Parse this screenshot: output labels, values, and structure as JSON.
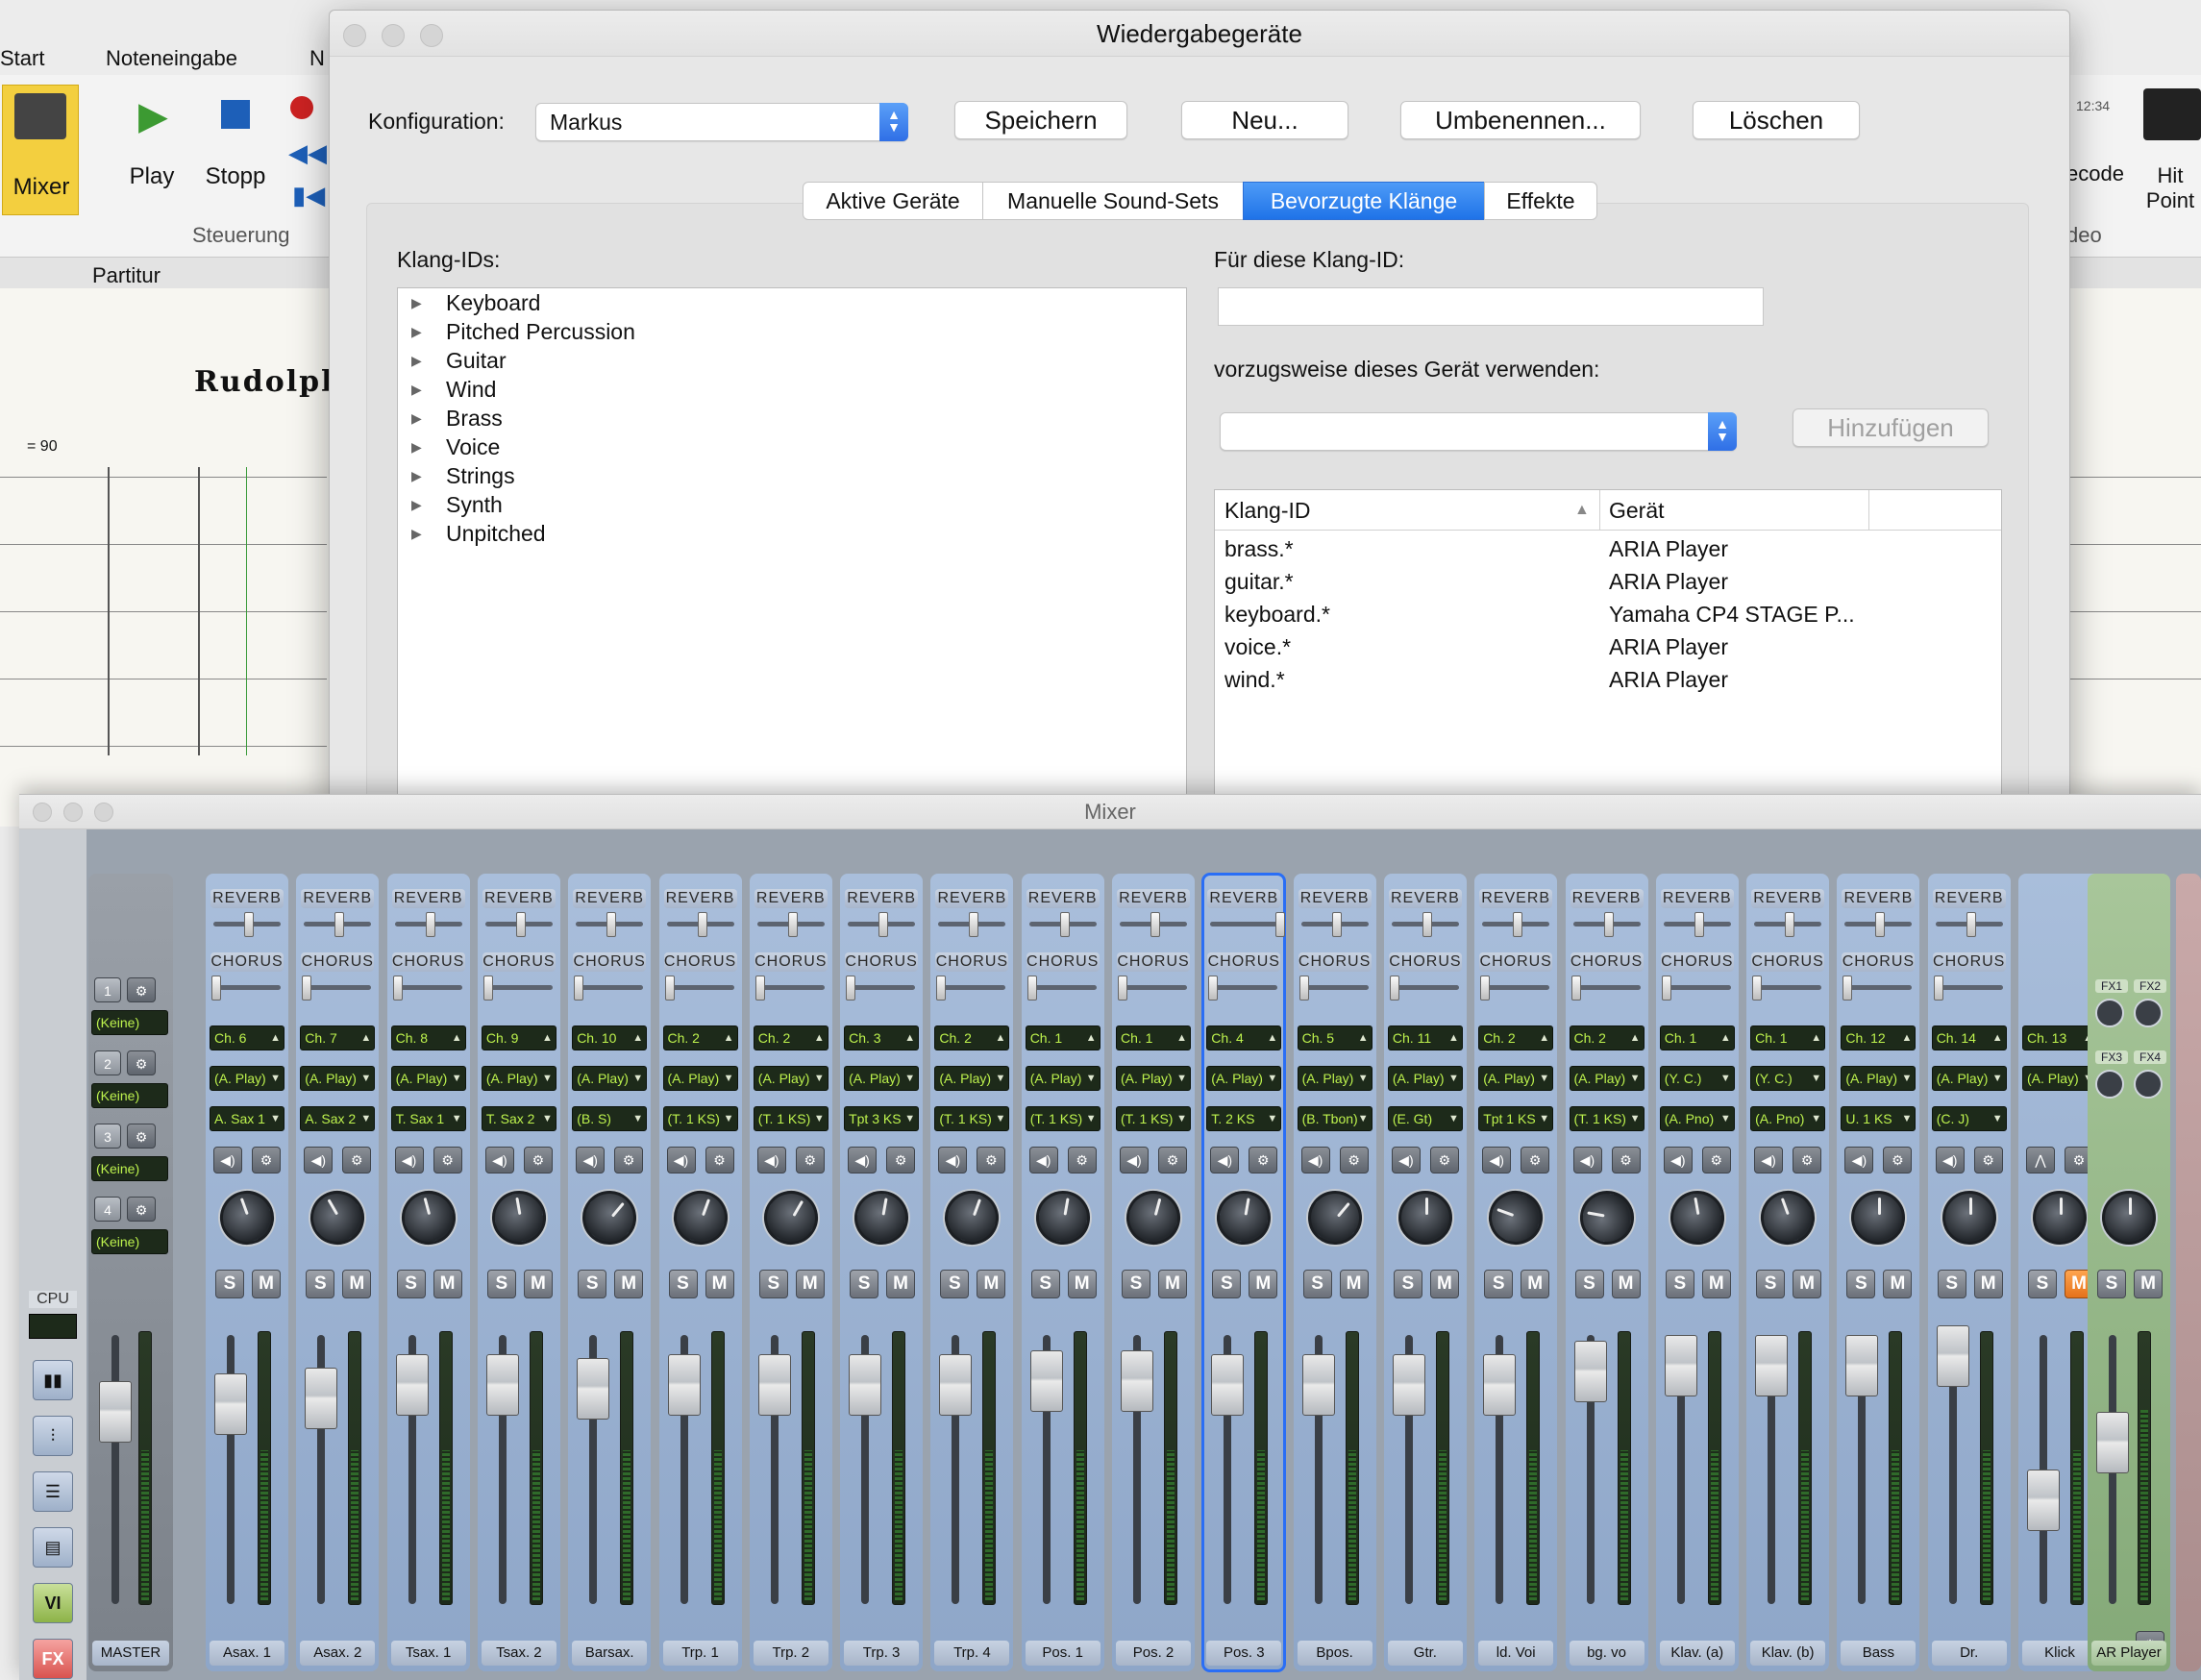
{
  "background_app": {
    "tabs": [
      "Start",
      "Noteneingabe",
      "N"
    ],
    "buttons": {
      "mixer": "Mixer",
      "play": "Play",
      "stopp": "Stopp"
    },
    "groups": {
      "steuerung": "Steuerung",
      "partitur": "Partitur",
      "timecode": "ecode",
      "hitpoint": "Hit Point",
      "video": "deo",
      "time": "12:34"
    },
    "score_title": "Rudolph, T",
    "tempo": "= 90"
  },
  "dialog": {
    "title": "Wiedergabegeräte",
    "config_label": "Konfiguration:",
    "config_value": "Markus",
    "buttons": [
      "Speichern",
      "Neu...",
      "Umbenennen...",
      "Löschen"
    ],
    "tabs": [
      "Aktive Geräte",
      "Manuelle Sound-Sets",
      "Bevorzugte Klänge",
      "Effekte"
    ],
    "selected_tab": "Bevorzugte Klänge",
    "klang_ids_label": "Klang-IDs:",
    "klang_ids": [
      "Keyboard",
      "Pitched Percussion",
      "Guitar",
      "Wind",
      "Brass",
      "Voice",
      "Strings",
      "Synth",
      "Unpitched"
    ],
    "fuer_label": "Für diese Klang-ID:",
    "fuer_value": "",
    "geraet_label": "vorzugsweise dieses Gerät verwenden:",
    "geraet_value": "",
    "add_button": "Hinzufügen",
    "table": {
      "col_klang": "Klang-ID",
      "col_geraet": "Gerät",
      "rows": [
        {
          "id": "brass.*",
          "device": "ARIA Player"
        },
        {
          "id": "guitar.*",
          "device": "ARIA Player"
        },
        {
          "id": "keyboard.*",
          "device": "Yamaha CP4 STAGE P..."
        },
        {
          "id": "voice.*",
          "device": "ARIA Player"
        },
        {
          "id": "wind.*",
          "device": "ARIA Player"
        }
      ]
    }
  },
  "mixer": {
    "title": "Mixer",
    "reverb": "REVERB",
    "chorus": "CHORUS",
    "solo": "S",
    "mute": "M",
    "master": "MASTER",
    "cpu": "CPU",
    "sidebar_buttons": [
      "VI",
      "FX"
    ],
    "buses": [
      {
        "num": "1",
        "value": "(Keine)"
      },
      {
        "num": "2",
        "value": "(Keine)"
      },
      {
        "num": "3",
        "value": "(Keine)"
      },
      {
        "num": "4",
        "value": "(Keine)"
      }
    ],
    "strips": [
      {
        "name": "Asax. 1",
        "ch": "Ch. 6",
        "dev": "(A. Play)",
        "prog": "A. Sax 1"
      },
      {
        "name": "Asax. 2",
        "ch": "Ch. 7",
        "dev": "(A. Play)",
        "prog": "A. Sax 2"
      },
      {
        "name": "Tsax. 1",
        "ch": "Ch. 8",
        "dev": "(A. Play)",
        "prog": "T. Sax 1"
      },
      {
        "name": "Tsax. 2",
        "ch": "Ch. 9",
        "dev": "(A. Play)",
        "prog": "T. Sax 2"
      },
      {
        "name": "Barsax.",
        "ch": "Ch. 10",
        "dev": "(A. Play)",
        "prog": "(B. S)"
      },
      {
        "name": "Trp. 1",
        "ch": "Ch. 2",
        "dev": "(A. Play)",
        "prog": "(T. 1 KS)"
      },
      {
        "name": "Trp. 2",
        "ch": "Ch. 2",
        "dev": "(A. Play)",
        "prog": "(T. 1 KS)"
      },
      {
        "name": "Trp. 3",
        "ch": "Ch. 3",
        "dev": "(A. Play)",
        "prog": "Tpt 3 KS"
      },
      {
        "name": "Trp. 4",
        "ch": "Ch. 2",
        "dev": "(A. Play)",
        "prog": "(T. 1 KS)"
      },
      {
        "name": "Pos. 1",
        "ch": "Ch. 1",
        "dev": "(A. Play)",
        "prog": "(T. 1 KS)"
      },
      {
        "name": "Pos. 2",
        "ch": "Ch. 1",
        "dev": "(A. Play)",
        "prog": "(T. 1 KS)"
      },
      {
        "name": "Pos. 3",
        "ch": "Ch. 4",
        "dev": "(A. Play)",
        "prog": "T. 2 KS"
      },
      {
        "name": "Bpos.",
        "ch": "Ch. 5",
        "dev": "(A. Play)",
        "prog": "(B. Tbon)"
      },
      {
        "name": "Gtr.",
        "ch": "Ch. 11",
        "dev": "(A. Play)",
        "prog": "(E. Gt)"
      },
      {
        "name": "ld. Voi",
        "ch": "Ch. 2",
        "dev": "(A. Play)",
        "prog": "Tpt 1 KS"
      },
      {
        "name": "bg. vo",
        "ch": "Ch. 2",
        "dev": "(A. Play)",
        "prog": "(T. 1 KS)"
      },
      {
        "name": "Klav. (a)",
        "ch": "Ch. 1",
        "dev": "(Y. C.)",
        "prog": "(A. Pno)"
      },
      {
        "name": "Klav. (b)",
        "ch": "Ch. 1",
        "dev": "(Y. C.)",
        "prog": "(A. Pno)"
      },
      {
        "name": "Bass",
        "ch": "Ch. 12",
        "dev": "(A. Play)",
        "prog": "U. 1 KS"
      },
      {
        "name": "Dr.",
        "ch": "Ch. 14",
        "dev": "(A. Play)",
        "prog": "(C. J)"
      },
      {
        "name": "Klick",
        "ch": "Ch. 13",
        "dev": "(A. Play)",
        "prog": ""
      }
    ],
    "selected_strip": "Pos. 3",
    "ar_player": {
      "name": "AR Player",
      "fx": [
        "FX1",
        "FX2",
        "FX3",
        "FX4"
      ]
    }
  },
  "colors": {
    "accent": "#2f74e8",
    "strip": "#9fb4d3",
    "fx_strip": "#98b98a",
    "lcd_text": "#bdf24d",
    "mute_on": "#f08a2c"
  }
}
